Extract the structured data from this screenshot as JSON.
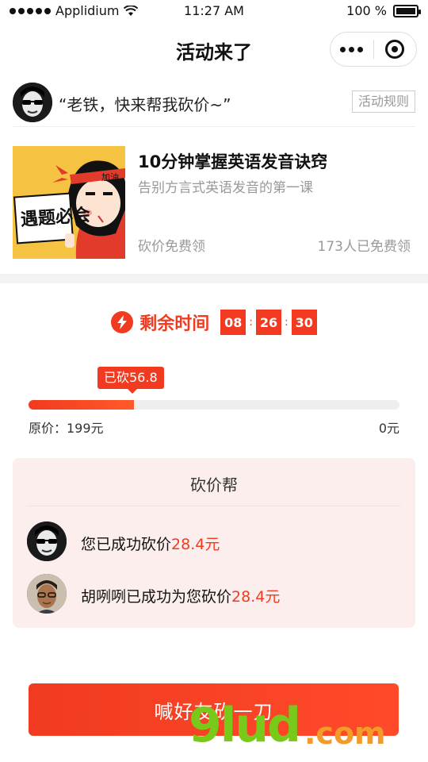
{
  "status_bar": {
    "carrier": "Applidium",
    "time": "11:27 AM",
    "battery": "100 %"
  },
  "nav": {
    "title": "活动来了"
  },
  "invite": {
    "message": "“老铁，快来帮我砍价~”",
    "rules_label": "活动规则"
  },
  "course": {
    "title": "10分钟掌握英语发音诀窍",
    "subtitle": "告别方言式英语发音的第一课",
    "free_label": "砍价免费领",
    "claimed": "173人已免费领",
    "cover_headband": "加油",
    "cover_sign": "遇题必会"
  },
  "timer": {
    "label": "剩余时间",
    "hours": "08",
    "minutes": "26",
    "seconds": "30"
  },
  "bargain": {
    "cut_label": "已砍56.8",
    "original_price": "原价：199元",
    "target_price": "0元",
    "progress": 0.285
  },
  "helpers": {
    "title": "砍价帮",
    "rows": [
      {
        "prefix": "您已成功砍价",
        "amount": "28.4元"
      },
      {
        "prefix": "胡咧咧已成功为您砍价",
        "amount": "28.4元"
      }
    ]
  },
  "cta": {
    "label": "喊好友砍一刀"
  },
  "watermark": {
    "brand": "9lud",
    "domain": ".com"
  },
  "colors": {
    "accent": "#f13a1f",
    "panel": "#fdeeee",
    "muted": "#999999"
  }
}
